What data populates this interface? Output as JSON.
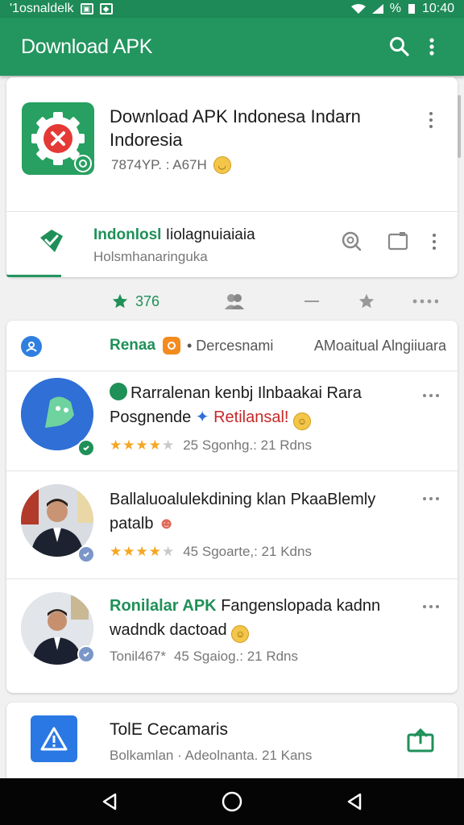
{
  "status_bar": {
    "left_text": "'1osnaldelk",
    "battery_text": "%",
    "time": "10:40"
  },
  "app_bar": {
    "title": "Download APK",
    "icons": [
      "search-icon",
      "more-vert-icon"
    ]
  },
  "hero": {
    "title": "Download APK Indonesa Indarn Indoresia",
    "meta": "7874YP. : A67H",
    "sub_title_highlight": "Indonlosl",
    "sub_title_rest": "Iiolagnuiaiaia",
    "sub_desc": "Holsmhanaringuka",
    "actions": [
      "find-icon",
      "window-icon",
      "more-vert-icon"
    ]
  },
  "tabs": [
    {
      "icon": "star-icon",
      "label": "376",
      "active": true
    },
    {
      "icon": "people-icon",
      "label": ""
    },
    {
      "icon": "minus-icon",
      "label": ""
    },
    {
      "icon": "star-outline-icon",
      "label": ""
    },
    {
      "icon": "more-horiz-icon",
      "label": ""
    }
  ],
  "list": {
    "header": {
      "title": "Renaa",
      "sub": "• Dercesnami",
      "right": "AMoaitual Alngiiuara"
    },
    "items": [
      {
        "title_line1": "Rarralenan kenbj Ilnbaakai Rara",
        "title_line2_plain": "Posgnende",
        "title_line2_red": "Retilansal!",
        "rating": 4,
        "meta": "25 Sgonhg.: 21 Rdns"
      },
      {
        "title_line1": "Ballaluoalulekdining klan PkaaBlemly",
        "title_line2_plain": "patalb",
        "rating": 4,
        "meta": "45 Sgoarte,: 21 Kdns"
      },
      {
        "title_highlight": "Ronilalar APK",
        "title_line1_rest": "Fangenslopada kadnn",
        "title_line2_plain": "wadndk dactoad",
        "prefix": "Tonil467*",
        "meta": "45 Sgaiog.: 21 Rdns"
      }
    ]
  },
  "bottom_card": {
    "title": "TolE Cecamaris",
    "meta": "Bolkamlan · Adeolnanta. 21 Kans"
  },
  "nav": [
    "back-icon",
    "home-icon",
    "recents-icon"
  ],
  "colors": {
    "primary": "#23955f",
    "primary_dark": "#1e8a57",
    "accent_blue": "#2a78e4",
    "star": "#f5a623"
  }
}
